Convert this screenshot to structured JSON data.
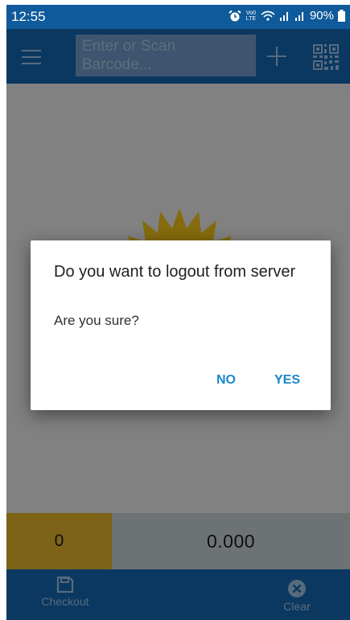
{
  "status_bar": {
    "time": "12:55",
    "network_badge": "Vo0 LTE",
    "battery": "90%"
  },
  "toolbar": {
    "search_placeholder": "Enter or Scan Barcode...",
    "menu_icon": "hamburger-menu-icon",
    "add_icon": "plus-icon",
    "scan_icon": "qr-code-icon"
  },
  "totals": {
    "quantity": "0",
    "amount": "0.000"
  },
  "bottom_nav": {
    "checkout_label": "Checkout",
    "clear_label": "Clear"
  },
  "dialog": {
    "title": "Do you want to logout from server",
    "message": "Are you sure?",
    "no_label": "NO",
    "yes_label": "YES"
  },
  "colors": {
    "toolbar": "#1567b0",
    "status_bar": "#0f5a9a",
    "quantity_box": "#e3b42a",
    "amount_box": "#c7cfd6",
    "dialog_button": "#1a87c9"
  }
}
